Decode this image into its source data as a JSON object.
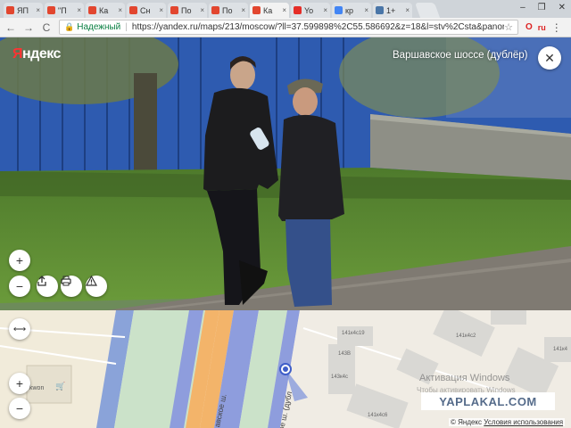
{
  "browser": {
    "tabs": [
      {
        "label": "ЯП",
        "favicon_color": "#e2462f"
      },
      {
        "label": "\"П",
        "favicon_color": "#e2462f"
      },
      {
        "label": "Ка",
        "favicon_color": "#e2462f"
      },
      {
        "label": "Сн",
        "favicon_color": "#e2462f"
      },
      {
        "label": "По",
        "favicon_color": "#e2462f"
      },
      {
        "label": "По",
        "favicon_color": "#e2462f"
      },
      {
        "label": "Ка",
        "favicon_color": "#e2462f",
        "active": true
      },
      {
        "label": "Yo",
        "favicon_color": "#e52d27"
      },
      {
        "label": "кр",
        "favicon_color": "#4285f4"
      },
      {
        "label": "1+",
        "favicon_color": "#4a76a8"
      }
    ],
    "tab_close_glyph": "×",
    "window_controls": {
      "minimize": "–",
      "restore": "❐",
      "close": "✕"
    },
    "nav": {
      "back": "←",
      "forward": "→",
      "reload": "C"
    },
    "address": {
      "secure_label": "Надежный",
      "url": "https://yandex.ru/maps/213/moscow/?ll=37.599898%2C55.586692&z=18&l=stv%2Csta&panorama%5Bpoint"
    },
    "ext_badge_1": "O",
    "ext_badge_2": "ru",
    "menu_glyph": "⋮"
  },
  "panorama": {
    "logo_ya": "Я",
    "logo_rest": "ндекс",
    "title": "Варшавское шоссе (дублёр)",
    "close_glyph": "✕",
    "zoom_in": "+",
    "zoom_out": "−",
    "share_icon": "share-icon",
    "print_icon": "print-icon",
    "report_icon": "warning-icon"
  },
  "map": {
    "collapse_glyph": "⟷",
    "zoom_in": "+",
    "zoom_out": "−",
    "building_labels": [
      "141к4с19",
      "141к4с2",
      "141к4",
      "143В",
      "143к4с",
      "141к4с6"
    ],
    "shop_label": "kwon",
    "street_1": "авское ш.",
    "street_2": "ое ш. (дубл",
    "windows_activation_1": "Активация Windows",
    "windows_activation_2": "Чтобы активировать Windows",
    "watermark": "YAPLAKAL.COM",
    "copyright_prefix": "© Яндекс",
    "terms_link": "Условия использования"
  }
}
